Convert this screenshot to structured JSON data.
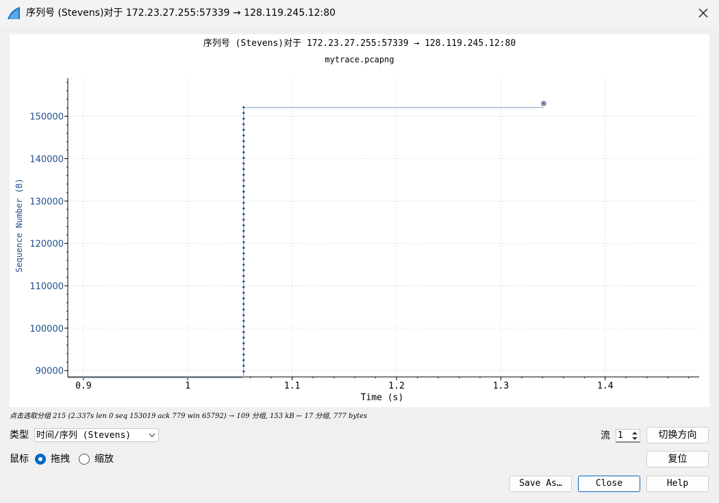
{
  "window": {
    "title": "序列号 (Stevens)对于 172.23.27.255:57339 → 128.119.245.12:80"
  },
  "colors": {
    "accent": "#0067c0",
    "series": "#1f4e8c",
    "series_line": "#aabbcc",
    "axis_text": "#1f4e8c"
  },
  "chart_data": {
    "type": "scatter",
    "title": "序列号 (Stevens)对于 172.23.27.255:57339 → 128.119.245.12:80",
    "subtitle": "mytrace.pcapng",
    "xlabel": "Time (s)",
    "ylabel": "Sequence Number (B)",
    "xlim": [
      0.885,
      1.49
    ],
    "ylim": [
      88500,
      159000
    ],
    "xticks": [
      0.9,
      1,
      1.1,
      1.2,
      1.3,
      1.4
    ],
    "xtick_labels": [
      "0.9",
      "1",
      "1.1",
      "1.2",
      "1.3",
      "1.4"
    ],
    "yticks": [
      90000,
      100000,
      110000,
      120000,
      130000,
      140000,
      150000
    ],
    "ytick_labels": [
      "90000",
      "100000",
      "110000",
      "120000",
      "130000",
      "140000",
      "150000"
    ],
    "grid": true,
    "series": [
      {
        "name": "",
        "burst_time": 1.0535,
        "burst_seq_start": 89800,
        "burst_seq_end": 152100,
        "burst_points": 48,
        "final_point": [
          1.341,
          153019
        ],
        "step_line": [
          [
            0.885,
            88300
          ],
          [
            1.0535,
            88300
          ],
          [
            1.0535,
            152100
          ],
          [
            1.341,
            152100
          ]
        ]
      }
    ]
  },
  "status": {
    "hint": "点击选取分组 215 (2.337s len 0 seq 153019 ack 779 win 65792) → 109 分组, 153 kB ← 17 分组, 777 bytes"
  },
  "controls": {
    "type_label": "类型",
    "type_value": "时间/序列 (Stevens)",
    "mouse_label": "鼠标",
    "drag_label": "拖拽",
    "zoom_label": "缩放",
    "stream_label": "流",
    "stream_value": "1",
    "switch_direction": "切换方向",
    "reset": "复位",
    "save_as": "Save As…",
    "close": "Close",
    "help": "Help"
  }
}
